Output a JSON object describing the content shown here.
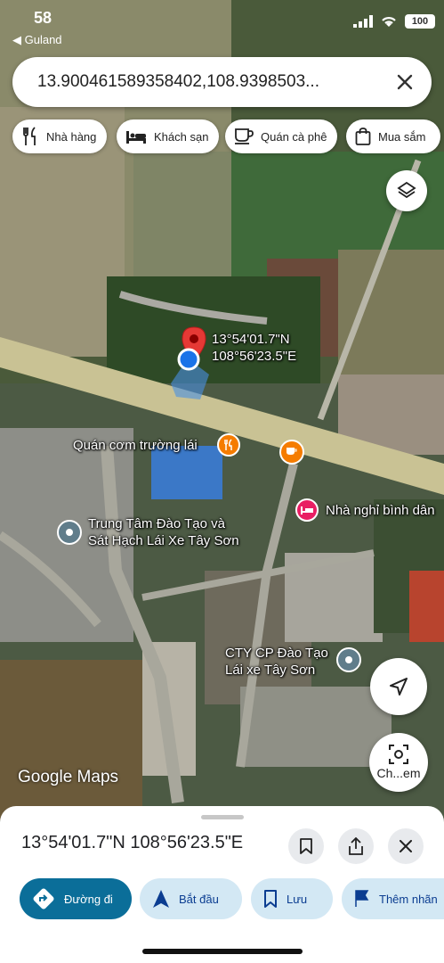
{
  "status_bar": {
    "time": "58",
    "back_app": "Guland",
    "battery": "100"
  },
  "search": {
    "value": "13.900461589358402,108.9398503..."
  },
  "chips": [
    {
      "label": "Nhà hàng",
      "icon": "fork-knife-icon"
    },
    {
      "label": "Khách sạn",
      "icon": "bed-icon"
    },
    {
      "label": "Quán cà phê",
      "icon": "coffee-cup-icon"
    },
    {
      "label": "Mua sắm",
      "icon": "shopping-bag-icon"
    }
  ],
  "map": {
    "pin_coords_lat": "13°54'01.7\"N",
    "pin_coords_lng": "108°56'23.5\"E",
    "places": [
      {
        "name": "Quán cơm trường lái",
        "icon": "restaurant-icon"
      },
      {
        "name": "Nhà nghỉ bình dân",
        "icon": "hotel-icon"
      },
      {
        "line1": "Trung Tâm Đào Tạo và",
        "line2": "Sát Hạch Lái Xe Tây Sơn",
        "icon": "place-icon"
      },
      {
        "line1": "CTY CP Đào Tạo",
        "line2": "Lái xe Tây Sơn",
        "icon": "place-icon"
      }
    ],
    "cafe_icon": "coffee-cup-icon",
    "camera_label": "Ch...em",
    "attribution": "Google Maps"
  },
  "sheet": {
    "title": "13°54'01.7\"N 108°56'23.5\"E",
    "actions": [
      {
        "label": "Đường đi",
        "icon": "directions-icon"
      },
      {
        "label": "Bắt đầu",
        "icon": "navigation-arrow-icon"
      },
      {
        "label": "Lưu",
        "icon": "bookmark-icon"
      },
      {
        "label": "Thêm nhãn",
        "icon": "flag-icon"
      }
    ]
  },
  "colors": {
    "primary_action": "#0b6e99",
    "secondary_action": "#d3e8f4",
    "pin_red": "#e53935",
    "location_blue": "#1a73e8"
  }
}
